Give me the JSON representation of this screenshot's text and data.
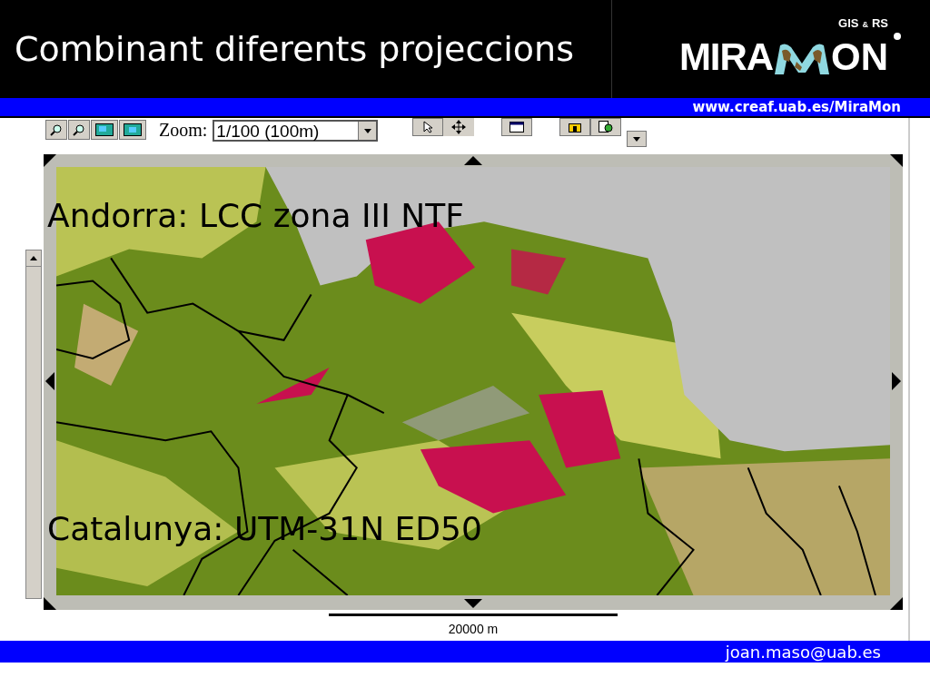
{
  "slide_title": "Combinant diferents projeccions",
  "logo": {
    "tagline_left": "GIS",
    "tagline_amp": "&",
    "tagline_right": "RS",
    "wordmark_left": "MIRA",
    "wordmark_right": "ON"
  },
  "url": "www.creaf.uab.es/MiraMon",
  "toolbar": {
    "zoom_label": "Zoom:",
    "zoom_value": "1/100 (100m)"
  },
  "map": {
    "labels": [
      "Andorra: LCC zona III NTF",
      "Catalunya: UTM-31N ED50"
    ],
    "scale_label": "20000 m"
  },
  "footer": {
    "email": "joan.maso@uab.es"
  }
}
